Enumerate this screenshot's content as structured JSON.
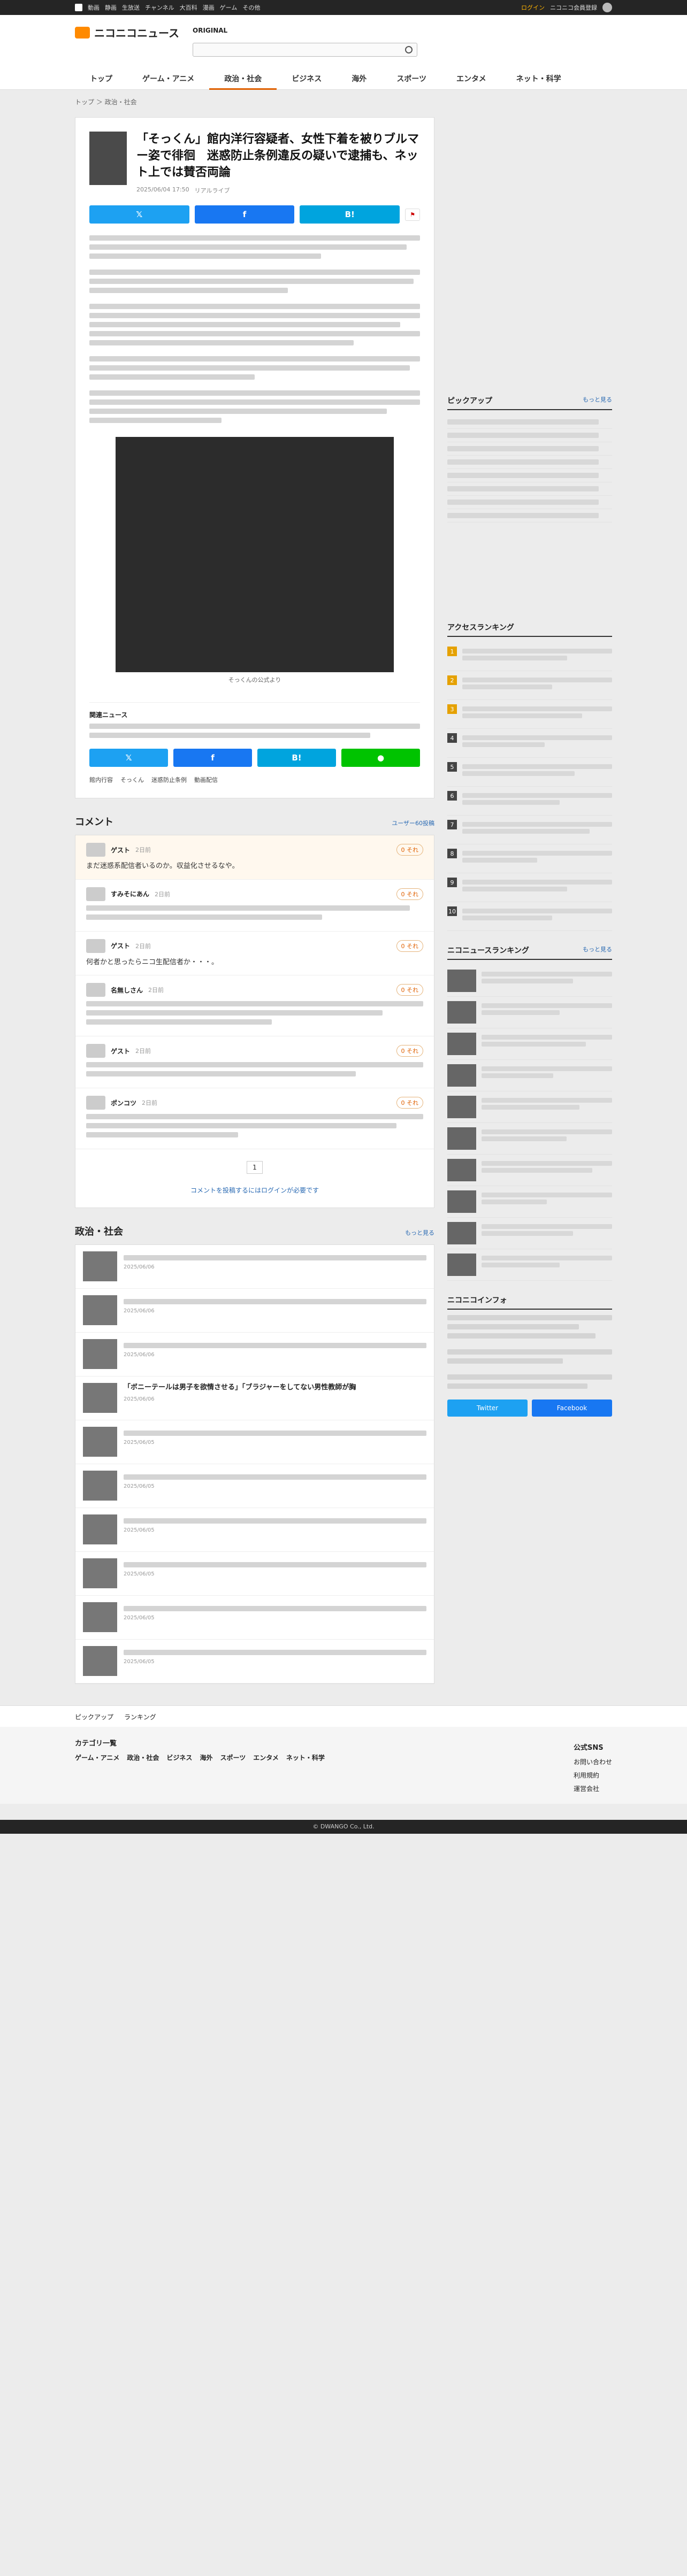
{
  "topbar": {
    "links": [
      "動画",
      "静画",
      "生放送",
      "チャンネル",
      "大百科",
      "漫画",
      "ゲーム",
      "その他"
    ],
    "login": "ログイン",
    "premium": "ニコニコ会員登録"
  },
  "header": {
    "brand": "ニコニコニュース",
    "original": "ORIGINAL",
    "nav": [
      "トップ",
      "ゲーム・アニメ",
      "政治・社会",
      "ビジネス",
      "海外",
      "スポーツ",
      "エンタメ",
      "ネット・科学"
    ]
  },
  "breadcrumb": "トップ ＞ 政治・社会",
  "article": {
    "title": "「そっくん」館内洋行容疑者、女性下着を被りブルマー姿で徘徊　迷惑防止条例違反の疑いで逮捕も、ネット上では賛否両論",
    "date": "2025/06/04 17:50",
    "source": "リアルライブ",
    "share": {
      "twitter": "",
      "facebook": "",
      "hatena": "B!"
    },
    "photo_caption": "そっくんの公式より",
    "section_source": "関連ニュース"
  },
  "tags": [
    "館内行容",
    "そっくん",
    "迷惑防止条例",
    "動画配信"
  ],
  "comments_section": {
    "title": "コメント",
    "more": "ユーザー60投稿",
    "items": [
      {
        "name": "ゲスト",
        "time": "2日前",
        "like": "0 それ",
        "body": "まだ迷惑系配信者いるのか。収益化させるなや。"
      },
      {
        "name": "すみそにあん",
        "time": "2日前",
        "like": "0 それ",
        "body": ""
      },
      {
        "name": "ゲスト",
        "time": "2日前",
        "like": "0 それ",
        "body": "何者かと思ったらニコ生配信者か・・・。"
      },
      {
        "name": "名無しさん",
        "time": "2日前",
        "like": "0 それ",
        "body": ""
      },
      {
        "name": "ゲスト",
        "time": "2日前",
        "like": "0 それ",
        "body": ""
      },
      {
        "name": "ポンコツ",
        "time": "2日前",
        "like": "0 それ",
        "body": ""
      }
    ],
    "pager": "1",
    "login_note": "コメントを投稿するにはログインが必要です"
  },
  "news_section": {
    "title": "政治・社会",
    "more": "もっと見る",
    "items": [
      {
        "title": "",
        "date": "2025/06/06"
      },
      {
        "title": "",
        "date": "2025/06/06"
      },
      {
        "title": "",
        "date": "2025/06/06"
      },
      {
        "title": "「ボニーテールは男子を欲情させる」「ブラジャーをしてない男性教師が胸",
        "date": "2025/06/06"
      },
      {
        "title": "",
        "date": "2025/06/05"
      },
      {
        "title": "",
        "date": "2025/06/05"
      },
      {
        "title": "",
        "date": "2025/06/05"
      },
      {
        "title": "",
        "date": "2025/06/05"
      },
      {
        "title": "",
        "date": "2025/06/05"
      },
      {
        "title": "",
        "date": "2025/06/05"
      }
    ]
  },
  "sidebar": {
    "pickup_title": "ピックアップ",
    "pickup_more": "もっと見る",
    "access_title": "アクセスランキング",
    "niconews_title": "ニコニュースランキング",
    "niconico_info": "ニコニコインフォ",
    "x_btn": "Twitter",
    "fb_btn": "Facebook",
    "more": "もっと見る"
  },
  "footer": {
    "links": [
      "ピックアップ",
      "ランキング"
    ],
    "category_title": "カテゴリ一覧",
    "categories": [
      "ゲーム・アニメ",
      "政治・社会",
      "ビジネス",
      "海外",
      "スポーツ",
      "エンタメ",
      "ネット・科学"
    ],
    "sns_title": "公式SNS",
    "right_links": [
      "お問い合わせ",
      "利用規約",
      "運営会社"
    ],
    "copyright": "© DWANGO Co., Ltd."
  }
}
